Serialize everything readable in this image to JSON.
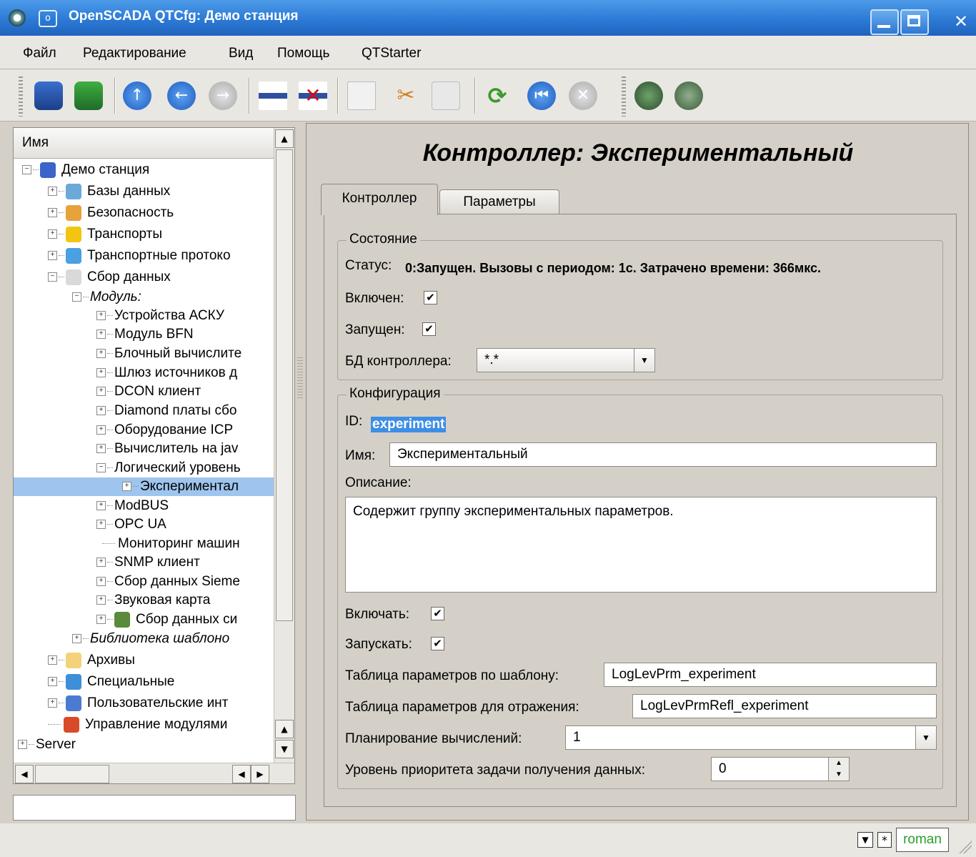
{
  "window": {
    "title": "OpenSCADA QTCfg: Демо станция"
  },
  "menu": {
    "items": [
      "Файл",
      "Редактирование",
      "Вид",
      "Помощь",
      "QTStarter"
    ]
  },
  "toolbar": {
    "icons": [
      "db-load-icon",
      "db-save-icon",
      "up-icon",
      "back-icon",
      "forward-icon",
      "add-item-icon",
      "delete-item-icon",
      "copy-icon",
      "cut-icon",
      "paste-icon",
      "refresh-icon",
      "start-icon",
      "stop-icon",
      "station-icon",
      "station-settings-icon"
    ]
  },
  "tree": {
    "header": "Имя",
    "rows": [
      {
        "label": "Демо станция",
        "exp": "⊟",
        "icon": "#3b63c9"
      },
      {
        "label": "Базы данных",
        "exp": "⊞",
        "icon": "#6aa9d8"
      },
      {
        "label": "Безопасность",
        "exp": "⊞",
        "icon": "#e7a23a"
      },
      {
        "label": "Транспорты",
        "exp": "⊞",
        "icon": "#f2c511"
      },
      {
        "label": "Транспортные протоко",
        "exp": "⊞",
        "icon": "#4aa0e0"
      },
      {
        "label": "Сбор данных",
        "exp": "⊟",
        "icon": "#d9d9d9"
      },
      {
        "label": "Модуль:",
        "exp": "⊟",
        "icon": ""
      },
      {
        "label": "Устройства АСКУ",
        "exp": "⊞",
        "icon": ""
      },
      {
        "label": "Модуль BFN",
        "exp": "⊞",
        "icon": ""
      },
      {
        "label": "Блочный вычислите",
        "exp": "⊞",
        "icon": ""
      },
      {
        "label": "Шлюз источников д",
        "exp": "⊞",
        "icon": ""
      },
      {
        "label": "DCON клиент",
        "exp": "⊞",
        "icon": ""
      },
      {
        "label": "Diamond платы сбо",
        "exp": "⊞",
        "icon": ""
      },
      {
        "label": "Оборудование ICP",
        "exp": "⊞",
        "icon": ""
      },
      {
        "label": "Вычислитель на jav",
        "exp": "⊞",
        "icon": ""
      },
      {
        "label": "Логический уровень",
        "exp": "⊟",
        "icon": ""
      },
      {
        "label": "Экспериментал",
        "exp": "⊞",
        "icon": ""
      },
      {
        "label": "ModBUS",
        "exp": "⊞",
        "icon": ""
      },
      {
        "label": "OPC UA",
        "exp": "⊞",
        "icon": ""
      },
      {
        "label": "Мониторинг машин",
        "exp": "",
        "icon": ""
      },
      {
        "label": "SNMP клиент",
        "exp": "⊞",
        "icon": ""
      },
      {
        "label": "Сбор данных Sieme",
        "exp": "⊞",
        "icon": ""
      },
      {
        "label": "Звуковая карта",
        "exp": "⊞",
        "icon": ""
      },
      {
        "label": "Сбор данных си",
        "exp": "⊞",
        "icon": "#5a8a3a"
      },
      {
        "label": "Библиотека шаблоно",
        "exp": "⊞",
        "icon": ""
      },
      {
        "label": "Архивы",
        "exp": "⊞",
        "icon": "#f3d27a"
      },
      {
        "label": "Специальные",
        "exp": "⊞",
        "icon": "#3c8fd8"
      },
      {
        "label": "Пользовательские инт",
        "exp": "⊞",
        "icon": "#4a7bd0"
      },
      {
        "label": "Управление модулями",
        "exp": "",
        "icon": "#d84a2a"
      },
      {
        "label": "Server",
        "exp": "⊞",
        "icon": ""
      }
    ]
  },
  "page": {
    "title": "Контроллер: Экспериментальный",
    "tabs": [
      "Контроллер",
      "Параметры"
    ],
    "state": {
      "group_title": "Состояние",
      "status_label": "Статус:",
      "status_value": "0:Запущен. Вызовы с периодом: 1с. Затрачено времени: 366мкс.",
      "enabled_label": "Включен:",
      "enabled_checked": "✔",
      "running_label": "Запущен:",
      "running_checked": "✔",
      "db_label": "БД контроллера:",
      "db_value": "*.*"
    },
    "config": {
      "group_title": "Конфигурация",
      "id_label": "ID:",
      "id_value": "experiment",
      "name_label": "Имя:",
      "name_value": "Экспериментальный",
      "descr_label": "Описание:",
      "descr_value": "Содержит группу экспериментальных параметров.",
      "to_enable_label": "Включать:",
      "to_enable_checked": "✔",
      "to_start_label": "Запускать:",
      "to_start_checked": "✔",
      "prm_table_label": "Таблица параметров по шаблону:",
      "prm_table_value": "LogLevPrm_experiment",
      "refl_table_label": "Таблица параметров для отражения:",
      "refl_table_value": "LogLevPrmRefl_experiment",
      "schedule_label": "Планирование вычислений:",
      "schedule_value": "1",
      "priority_label": "Уровень приоритета задачи получения данных:",
      "priority_value": "0"
    }
  },
  "statusbar": {
    "modified_mark": "*",
    "user": "roman"
  },
  "colors": {
    "titlebar": "#2c7ad6",
    "selection": "#9ec5ee",
    "id_highlight": "#3d8ee6"
  }
}
